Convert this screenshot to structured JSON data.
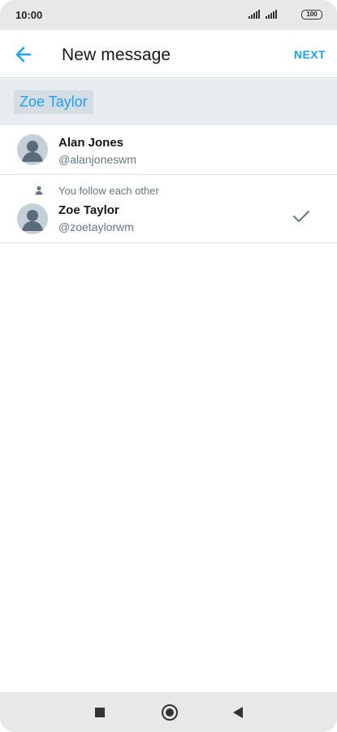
{
  "status_bar": {
    "time": "10:00",
    "battery": "100",
    "icons": [
      "signal-icon",
      "signal-icon",
      "battery-icon"
    ]
  },
  "header": {
    "title": "New message",
    "next_label": "NEXT",
    "back_icon": "arrow-left-icon"
  },
  "recipients": {
    "selected": [
      "Zoe Taylor"
    ]
  },
  "users": [
    {
      "name": "Alan Jones",
      "handle": "@alanjoneswm",
      "follow_note": "",
      "selected": false
    },
    {
      "name": "Zoe Taylor",
      "handle": "@zoetaylorwm",
      "follow_note": "You follow each other",
      "selected": true
    }
  ],
  "nav_bar": {
    "buttons": [
      "recent-apps-icon",
      "home-icon",
      "back-icon"
    ]
  },
  "colors": {
    "accent": "#1da1f2",
    "secondary_text": "#657786",
    "strip_background": "#e6ecf0",
    "avatar": "#c5cfd8"
  }
}
